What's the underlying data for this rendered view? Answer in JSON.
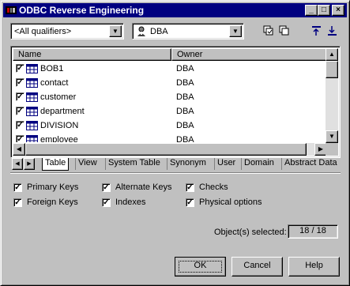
{
  "window": {
    "title": "ODBC Reverse Engineering",
    "controls": {
      "minimize": "_",
      "maximize": "□",
      "close": "×"
    }
  },
  "filters": {
    "qualifier": "<All qualifiers>",
    "owner": "DBA",
    "owner_icon": "user-icon"
  },
  "toolbar": {
    "select_all_icon": "select-all-icon",
    "deselect_all_icon": "deselect-all-icon",
    "move_up_icon": "move-up-icon",
    "move_down_icon": "move-down-icon"
  },
  "list": {
    "columns": [
      "Name",
      "Owner"
    ],
    "rows": [
      {
        "checked": true,
        "name": "BOB1",
        "owner": "DBA"
      },
      {
        "checked": true,
        "name": "contact",
        "owner": "DBA"
      },
      {
        "checked": true,
        "name": "customer",
        "owner": "DBA"
      },
      {
        "checked": true,
        "name": "department",
        "owner": "DBA"
      },
      {
        "checked": true,
        "name": "DIVISION",
        "owner": "DBA"
      },
      {
        "checked": true,
        "name": "employee",
        "owner": "DBA"
      }
    ]
  },
  "tabs": {
    "items": [
      "Table",
      "View",
      "System Table",
      "Synonym",
      "User",
      "Domain",
      "Abstract Data"
    ],
    "active": "Table"
  },
  "options": {
    "primary_keys": {
      "label": "Primary Keys",
      "checked": true
    },
    "foreign_keys": {
      "label": "Foreign Keys",
      "checked": true
    },
    "alternate_keys": {
      "label": "Alternate Keys",
      "checked": true
    },
    "indexes": {
      "label": "Indexes",
      "checked": true
    },
    "checks": {
      "label": "Checks",
      "checked": true
    },
    "physical_options": {
      "label": "Physical options",
      "checked": true
    }
  },
  "status": {
    "label": "Object(s) selected:",
    "value": "18 / 18"
  },
  "buttons": {
    "ok": "OK",
    "cancel": "Cancel",
    "help": "Help"
  }
}
